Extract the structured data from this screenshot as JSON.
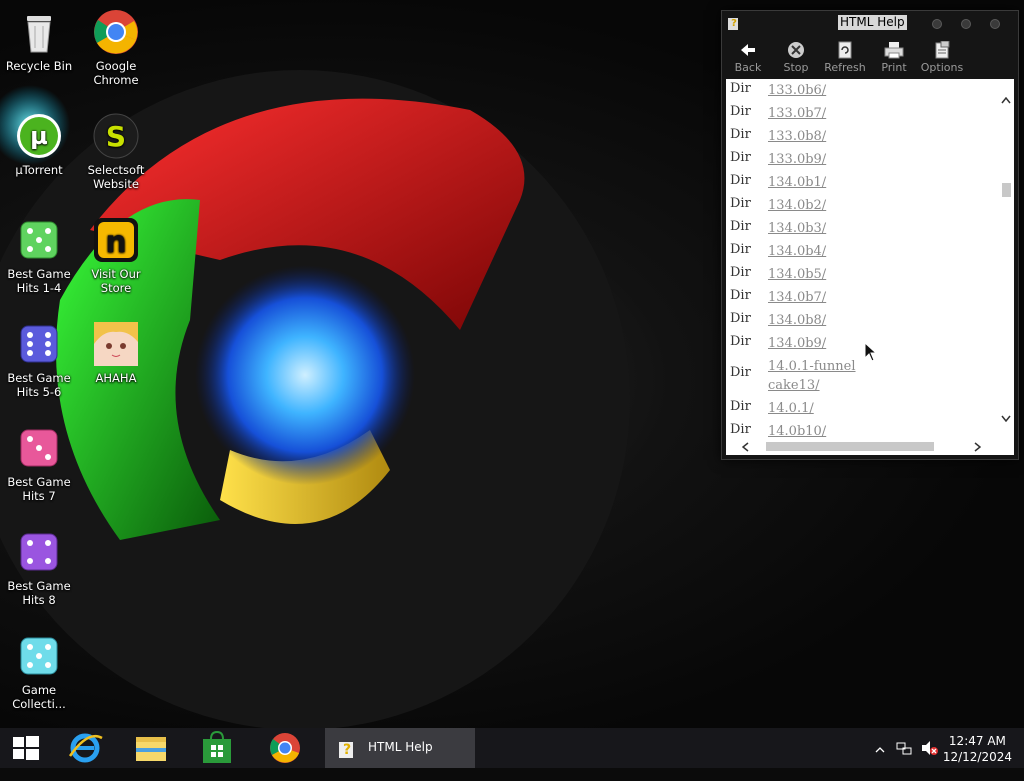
{
  "desktop": {
    "icons": [
      {
        "label": "Recycle Bin"
      },
      {
        "label": "Google Chrome"
      },
      {
        "label": "µTorrent"
      },
      {
        "label": "Selectsoft Website"
      },
      {
        "label": "Best Game Hits 1-4"
      },
      {
        "label": "Visit Our Store"
      },
      {
        "label": "Best Game Hits 5-6"
      },
      {
        "label": "AHAHA"
      },
      {
        "label": "Best Game Hits 7"
      },
      {
        "label": "Best Game Hits 8"
      },
      {
        "label": "Game Collecti..."
      }
    ]
  },
  "help_window": {
    "title": "HTML Help",
    "toolbar": {
      "back": "Back",
      "stop": "Stop",
      "refresh": "Refresh",
      "print": "Print",
      "options": "Options"
    },
    "rows": [
      {
        "kind": "Dir",
        "name": "133.0b6/"
      },
      {
        "kind": "Dir",
        "name": "133.0b7/"
      },
      {
        "kind": "Dir",
        "name": "133.0b8/"
      },
      {
        "kind": "Dir",
        "name": "133.0b9/"
      },
      {
        "kind": "Dir",
        "name": "134.0b1/"
      },
      {
        "kind": "Dir",
        "name": "134.0b2/"
      },
      {
        "kind": "Dir",
        "name": "134.0b3/"
      },
      {
        "kind": "Dir",
        "name": "134.0b4/"
      },
      {
        "kind": "Dir",
        "name": "134.0b5/"
      },
      {
        "kind": "Dir",
        "name": "134.0b7/"
      },
      {
        "kind": "Dir",
        "name": "134.0b8/"
      },
      {
        "kind": "Dir",
        "name": "134.0b9/"
      },
      {
        "kind": "Dir",
        "name": "14.0.1-funnelcake13/"
      },
      {
        "kind": "Dir",
        "name": "14.0.1/"
      },
      {
        "kind": "Dir",
        "name": "14.0b10/"
      }
    ]
  },
  "taskbar": {
    "active_window_label": "HTML Help",
    "clock_time": "12:47 AM",
    "clock_date": "12/12/2024"
  },
  "colors": {
    "taskbar": "#18181c",
    "link": "#8a8a8a",
    "window_frame": "#151515"
  }
}
